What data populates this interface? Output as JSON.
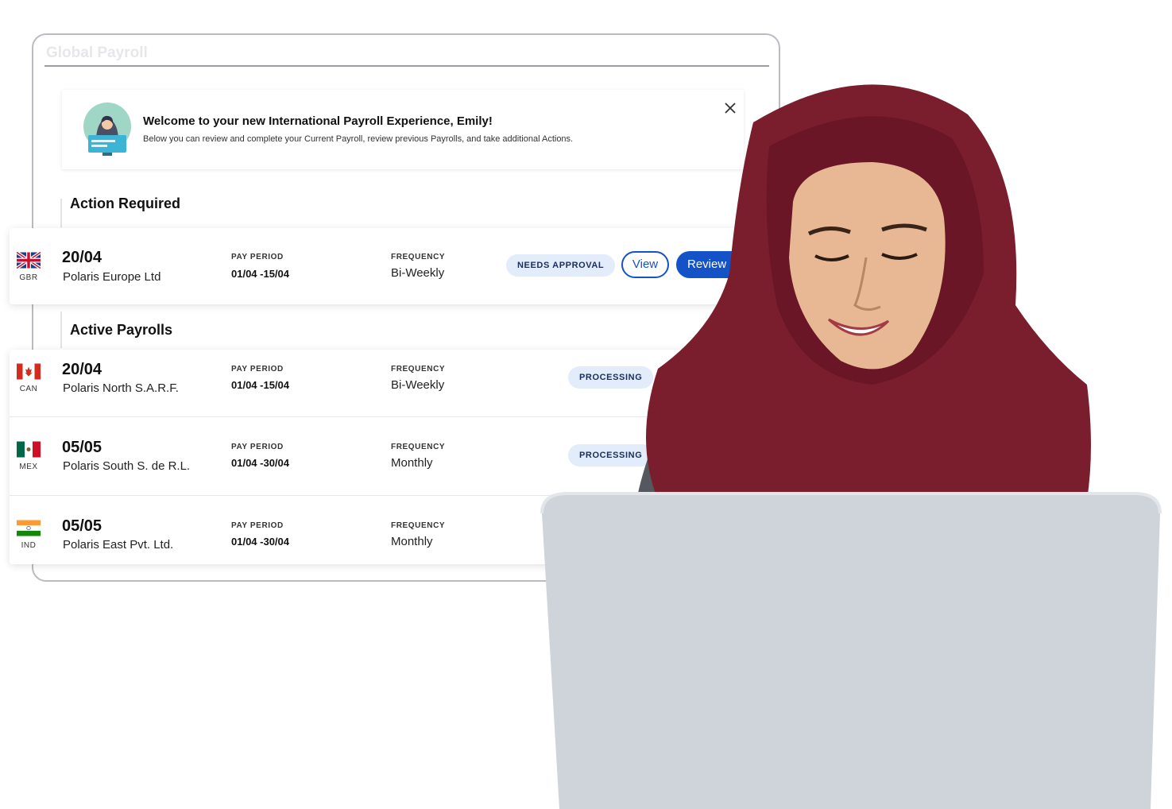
{
  "window": {
    "title": "Global Payroll"
  },
  "welcome": {
    "title": "Welcome to your new International Payroll Experience, Emily!",
    "subtitle": "Below you can review and complete your Current Payroll, review previous Payrolls, and take additional Actions."
  },
  "sections": {
    "action_required": "Action Required",
    "active_payrolls": "Active Payrolls"
  },
  "labels": {
    "pay_period": "PAY PERIOD",
    "frequency": "FREQUENCY"
  },
  "action_row": {
    "country": "GBR",
    "date": "20/04",
    "company": "Polaris Europe Ltd",
    "pay_period": "01/04 -15/04",
    "frequency": "Bi-Weekly",
    "status": "NEEDS APPROVAL",
    "view_label": "View",
    "review_label": "Review"
  },
  "active_rows": [
    {
      "country": "CAN",
      "date": "20/04",
      "company": "Polaris North S.A.R.F.",
      "pay_period": "01/04 -15/04",
      "frequency": "Bi-Weekly",
      "status": "PROCESSING"
    },
    {
      "country": "MEX",
      "date": "05/05",
      "company": "Polaris South S. de R.L.",
      "pay_period": "01/04 -30/04",
      "frequency": "Monthly",
      "status": "PROCESSING"
    },
    {
      "country": "IND",
      "date": "05/05",
      "company": "Polaris East Pvt. Ltd.",
      "pay_period": "01/04 -30/04",
      "frequency": "Monthly",
      "status": ""
    }
  ],
  "colors": {
    "primary": "#1452c8",
    "badge_bg": "#e3ecfb",
    "hijab": "#7a1e2e",
    "laptop": "#cfd4da"
  }
}
